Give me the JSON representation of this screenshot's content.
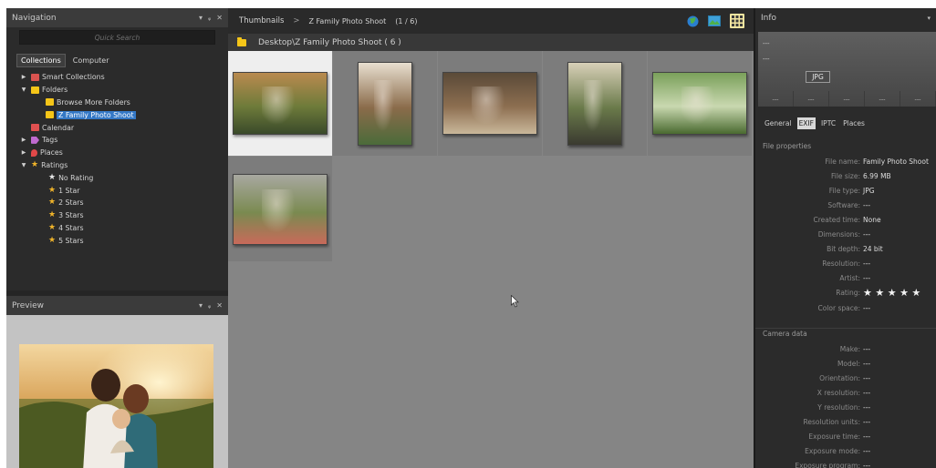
{
  "navigation": {
    "title": "Navigation",
    "controls": [
      "▾",
      "ᵩ",
      "✕"
    ],
    "quick_search_placeholder": "Quick Search",
    "tabs": [
      {
        "label": "Collections",
        "active": true
      },
      {
        "label": "Computer",
        "active": false
      }
    ],
    "tree": [
      {
        "label": "Smart Collections",
        "level": 1,
        "arrow": "▶",
        "icon": "smart-collections-icon",
        "color": "#d9534f"
      },
      {
        "label": "Folders",
        "level": 1,
        "arrow": "▼",
        "icon": "folder-icon",
        "color": "#f5c518"
      },
      {
        "label": "Browse More Folders",
        "level": 2,
        "arrow": "",
        "icon": "folder-browse-icon",
        "color": "#f5c518"
      },
      {
        "label": "Z Family Photo Shoot",
        "level": 2,
        "arrow": "",
        "icon": "folder-icon",
        "color": "#f5c518",
        "selected": true
      },
      {
        "label": "Calendar",
        "level": 1,
        "arrow": "",
        "icon": "calendar-icon",
        "color": "#e05050"
      },
      {
        "label": "Tags",
        "level": 1,
        "arrow": "▶",
        "icon": "tag-icon",
        "color": "#c06ad0"
      },
      {
        "label": "Places",
        "level": 1,
        "arrow": "▶",
        "icon": "pin-icon",
        "color": "#e04848"
      },
      {
        "label": "Ratings",
        "level": 1,
        "arrow": "▼",
        "icon": "star-icon",
        "color": "#f0b42a"
      },
      {
        "label": "No Rating",
        "level": 3,
        "arrow": "",
        "icon": "star-white-icon",
        "color": "#e6e6e6"
      },
      {
        "label": "1 Star",
        "level": 3,
        "arrow": "",
        "icon": "star-icon",
        "color": "#f0b42a"
      },
      {
        "label": "2 Stars",
        "level": 3,
        "arrow": "",
        "icon": "star-icon",
        "color": "#f0b42a"
      },
      {
        "label": "3 Stars",
        "level": 3,
        "arrow": "",
        "icon": "star-icon",
        "color": "#f0b42a"
      },
      {
        "label": "4 Stars",
        "level": 3,
        "arrow": "",
        "icon": "star-icon",
        "color": "#f0b42a"
      },
      {
        "label": "5 Stars",
        "level": 3,
        "arrow": "",
        "icon": "star-icon",
        "color": "#f0b42a"
      }
    ]
  },
  "preview": {
    "title": "Preview",
    "controls": [
      "▾",
      "ᵩ",
      "✕"
    ]
  },
  "thumbnails": {
    "label": "Thumbnails",
    "breadcrumb_sep": ">",
    "folder": "Z Family Photo Shoot",
    "count": "(1 / 6)",
    "path": "Desktop\\Z Family Photo Shoot ( 6 )",
    "view_icons": [
      "globe-icon",
      "photo-view-icon",
      "grid-view-icon"
    ],
    "items": [
      {
        "name": "thumb-1",
        "selected": true,
        "palette": [
          "#b98a4f",
          "#6e7b3a",
          "#3a4a2a"
        ]
      },
      {
        "name": "thumb-2",
        "selected": false,
        "palette": [
          "#e8dfd0",
          "#8a6b4a",
          "#4b6b3a"
        ]
      },
      {
        "name": "thumb-3",
        "selected": false,
        "palette": [
          "#5a4a38",
          "#8c6e50",
          "#c9b79a"
        ]
      },
      {
        "name": "thumb-4",
        "selected": false,
        "palette": [
          "#d8d0b8",
          "#6a7a4a",
          "#3a3a30"
        ]
      },
      {
        "name": "thumb-5",
        "selected": false,
        "palette": [
          "#7aa05a",
          "#c9d8b0",
          "#4a6a30"
        ]
      },
      {
        "name": "thumb-6",
        "selected": false,
        "palette": [
          "#a8a8a0",
          "#7a8a50",
          "#c86a5a"
        ]
      }
    ]
  },
  "info": {
    "title": "Info",
    "placeholders": [
      "---",
      "---"
    ],
    "format_badge": "JPG",
    "meta_cells": [
      "---",
      "---",
      "---",
      "---",
      "---"
    ],
    "tabs": [
      {
        "label": "General",
        "active": false
      },
      {
        "label": "EXIF",
        "active": true
      },
      {
        "label": "IPTC",
        "active": false
      },
      {
        "label": "Places",
        "active": false
      }
    ],
    "file_section": "File properties",
    "file_props": [
      {
        "k": "File name:",
        "v": "Family Photo Shoot"
      },
      {
        "k": "File size:",
        "v": "6.99 MB"
      },
      {
        "k": "File type:",
        "v": "JPG"
      },
      {
        "k": "Software:",
        "v": "---"
      },
      {
        "k": "Created time:",
        "v": "None"
      },
      {
        "k": "Dimensions:",
        "v": "---"
      },
      {
        "k": "Bit depth:",
        "v": "24 bit"
      },
      {
        "k": "Resolution:",
        "v": "---"
      },
      {
        "k": "Artist:",
        "v": "---"
      },
      {
        "k": "Rating:",
        "v": "★ ★ ★ ★ ★"
      },
      {
        "k": "Color space:",
        "v": "---"
      }
    ],
    "camera_section": "Camera data",
    "camera_props": [
      {
        "k": "Make:",
        "v": "---"
      },
      {
        "k": "Model:",
        "v": "---"
      },
      {
        "k": "Orientation:",
        "v": "---"
      },
      {
        "k": "X resolution:",
        "v": "---"
      },
      {
        "k": "Y resolution:",
        "v": "---"
      },
      {
        "k": "Resolution units:",
        "v": "---"
      },
      {
        "k": "Exposure time:",
        "v": "---"
      },
      {
        "k": "Exposure mode:",
        "v": "---"
      },
      {
        "k": "Exposure program:",
        "v": "---"
      }
    ]
  }
}
